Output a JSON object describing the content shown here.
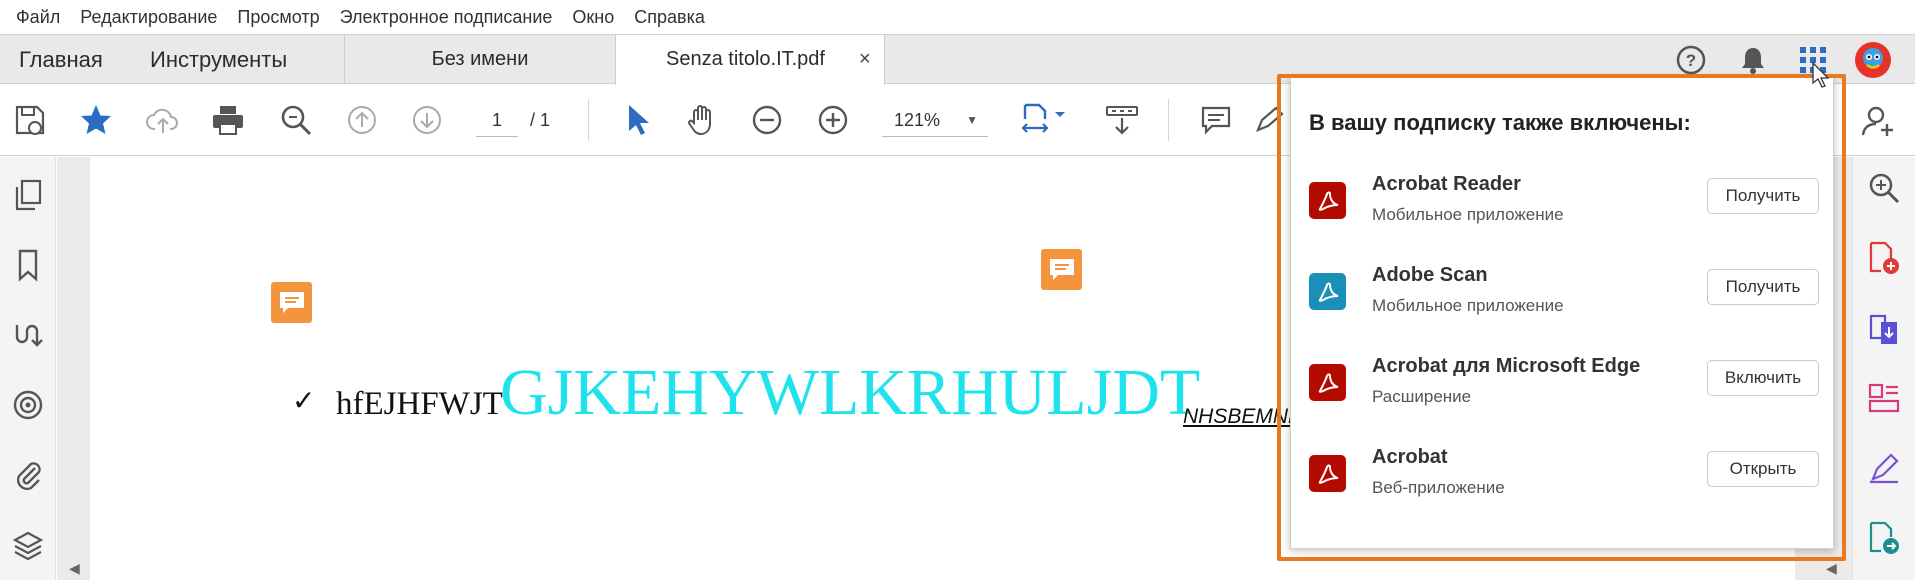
{
  "menu": [
    "Файл",
    "Редактирование",
    "Просмотр",
    "Электронное подписание",
    "Окно",
    "Справка"
  ],
  "tabs": {
    "home": "Главная",
    "tools": "Инструменты",
    "doc1": "Без имени",
    "doc2": "Senza titolo.IT.pdf",
    "close": "×"
  },
  "toolbar": {
    "page_current": "1",
    "page_total": "/ 1",
    "zoom": "121%"
  },
  "document": {
    "check": "✓",
    "small_text": "hfEJHFWJT",
    "big_text": "GJKEHYWLKRHULJDT",
    "underlined_text": "NHSBEMNHSBEM",
    "big_text_color": "#1ee3ee",
    "note_color": "#f4943d"
  },
  "popup": {
    "title": "В вашу подписку также включены:",
    "items": [
      {
        "name": "Acrobat Reader",
        "sub": "Мобильное приложение",
        "button": "Получить",
        "icon": "acrobat-reader-icon",
        "color": "#b30b00"
      },
      {
        "name": "Adobe Scan",
        "sub": "Мобильное приложение",
        "button": "Получить",
        "icon": "adobe-scan-icon",
        "color": "#1a8fb8"
      },
      {
        "name": "Acrobat для Microsoft Edge",
        "sub": "Расширение",
        "button": "Включить",
        "icon": "acrobat-edge-icon",
        "color": "#b30b00"
      },
      {
        "name": "Acrobat",
        "sub": "Веб-приложение",
        "button": "Открыть",
        "icon": "acrobat-web-icon",
        "color": "#b30b00"
      }
    ],
    "highlight_color": "#e8791e"
  }
}
